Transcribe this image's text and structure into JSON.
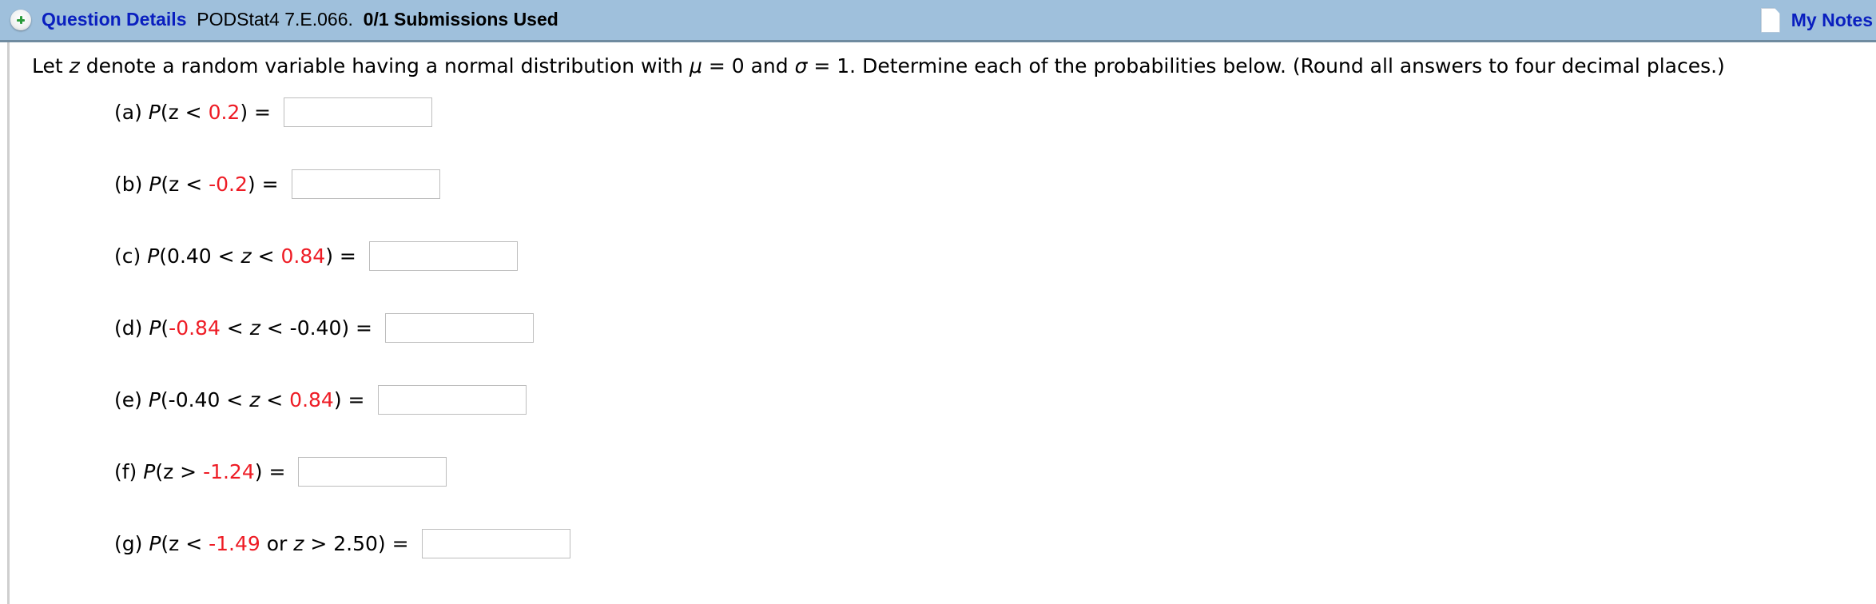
{
  "header": {
    "toggle_icon": "plus-circle-icon",
    "title_link": "Question Details",
    "question_id": "PODStat4 7.E.066.",
    "submissions": "0/1 Submissions Used",
    "notes_icon": "note-page-icon",
    "notes_label": "My Notes"
  },
  "question": {
    "intro": {
      "p1": "Let ",
      "z": "z",
      "p2": " denote a random variable having a normal distribution with ",
      "mu": "μ",
      "p3": " = 0 and ",
      "sigma": "σ",
      "p4": " = 1. Determine each of the probabilities below. (Round all answers to four decimal places.)"
    },
    "parts": [
      {
        "label": "(a) ",
        "segments": [
          {
            "t": "P",
            "s": "it"
          },
          {
            "t": "(z < "
          },
          {
            "t": "0.2",
            "s": "red"
          },
          {
            "t": ") ="
          }
        ],
        "answer": ""
      },
      {
        "label": "(b) ",
        "segments": [
          {
            "t": "P",
            "s": "it"
          },
          {
            "t": "(z < "
          },
          {
            "t": "-0.2",
            "s": "red"
          },
          {
            "t": ") ="
          }
        ],
        "answer": ""
      },
      {
        "label": "(c) ",
        "segments": [
          {
            "t": "P",
            "s": "it"
          },
          {
            "t": "(0.40 < "
          },
          {
            "t": "z",
            "s": "it"
          },
          {
            "t": " < "
          },
          {
            "t": "0.84",
            "s": "red"
          },
          {
            "t": ") ="
          }
        ],
        "answer": ""
      },
      {
        "label": "(d) ",
        "segments": [
          {
            "t": "P",
            "s": "it"
          },
          {
            "t": "("
          },
          {
            "t": "-0.84",
            "s": "red"
          },
          {
            "t": " < "
          },
          {
            "t": "z",
            "s": "it"
          },
          {
            "t": " < -0.40) ="
          }
        ],
        "answer": ""
      },
      {
        "label": "(e) ",
        "segments": [
          {
            "t": "P",
            "s": "it"
          },
          {
            "t": "(-0.40 < "
          },
          {
            "t": "z",
            "s": "it"
          },
          {
            "t": " < "
          },
          {
            "t": "0.84",
            "s": "red"
          },
          {
            "t": ") ="
          }
        ],
        "answer": ""
      },
      {
        "label": "(f) ",
        "segments": [
          {
            "t": "P",
            "s": "it"
          },
          {
            "t": "(z > "
          },
          {
            "t": "-1.24",
            "s": "red"
          },
          {
            "t": ") ="
          }
        ],
        "answer": ""
      },
      {
        "label": "(g) ",
        "segments": [
          {
            "t": "P",
            "s": "it"
          },
          {
            "t": "(z < "
          },
          {
            "t": "-1.49",
            "s": "red"
          },
          {
            "t": " or "
          },
          {
            "t": "z",
            "s": "it"
          },
          {
            "t": " > 2.50) ="
          }
        ],
        "answer": ""
      }
    ]
  },
  "colors": {
    "header_bg": "#9fc0dc",
    "link_blue": "#0a1fbf",
    "value_red": "#ee1c25"
  }
}
